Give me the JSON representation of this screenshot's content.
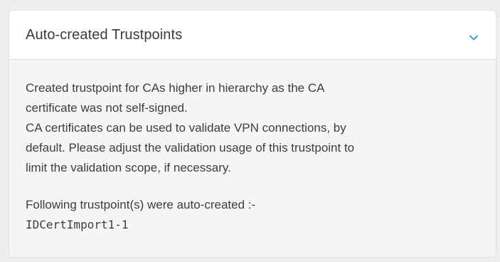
{
  "panel": {
    "title": "Auto-created Trustpoints",
    "toggle_icon": "chevron-down-icon",
    "accent_color": "#1a9ad6",
    "message_lines": [
      "Created trustpoint for CAs higher in hierarchy as the CA",
      "certificate was not self-signed.",
      "CA certificates can be used to validate VPN connections, by",
      "default. Please adjust the validation usage of this trustpoint to",
      "limit the validation scope, if necessary."
    ],
    "list_label": "Following trustpoint(s) were auto-created :-",
    "trustpoints": [
      "IDCertImport1-1"
    ]
  }
}
